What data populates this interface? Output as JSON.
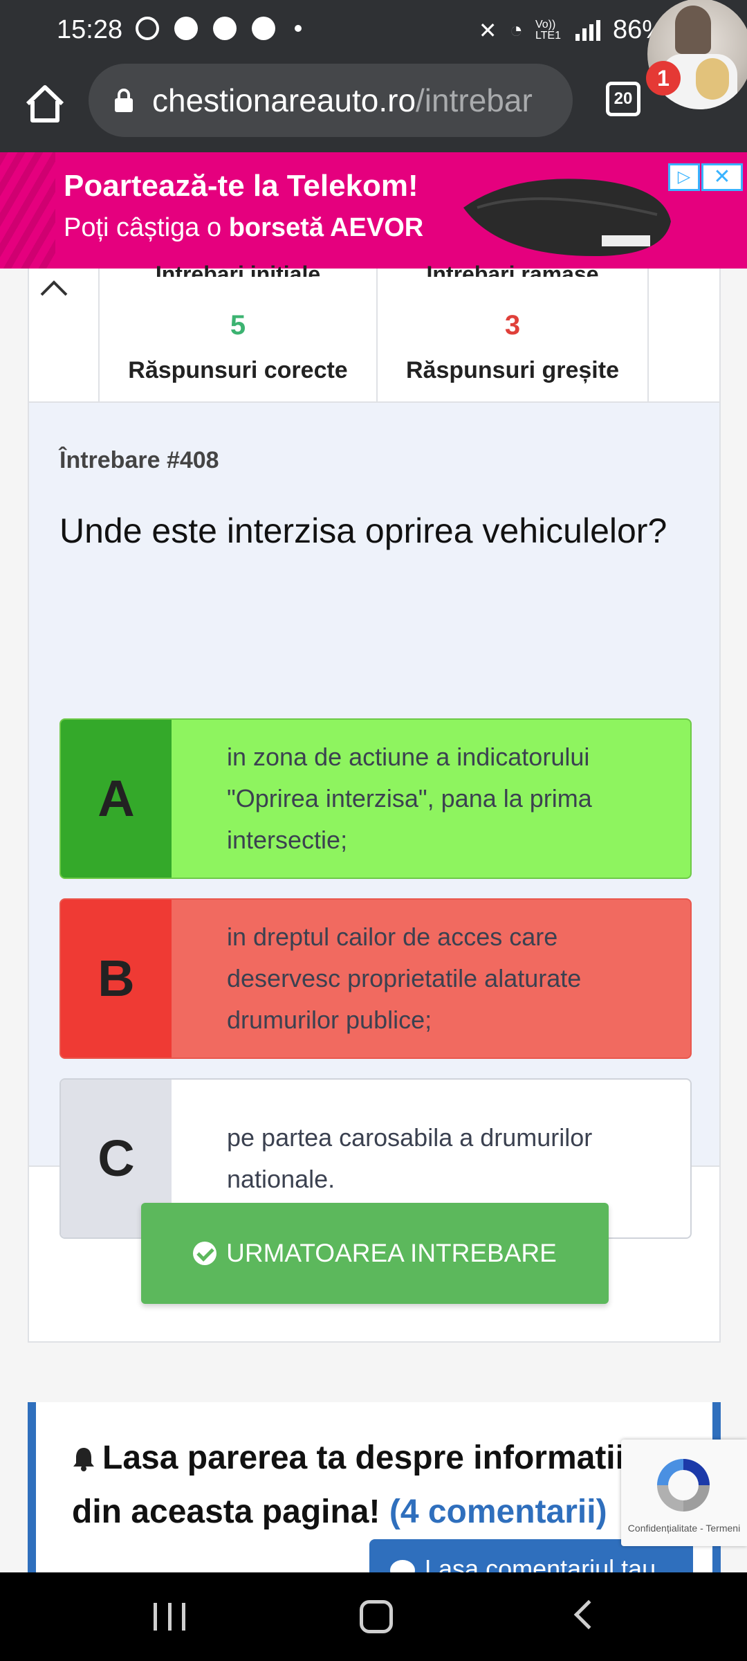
{
  "status_bar": {
    "time": "15:28",
    "battery": "86%",
    "network": "Vo)) LTE1"
  },
  "browser": {
    "url_host": "chestionareauto.ro",
    "url_path": "/intrebar",
    "tab_count": "20",
    "notification_count": "1"
  },
  "ad": {
    "title": "Poartează-te la Telekom!",
    "subtitle_plain": "Poți câștiga o ",
    "subtitle_bold": "borsetă AEVOR",
    "close_icon": "close-icon",
    "brand_color": "#e5007e"
  },
  "stats": {
    "clipped_left": "Intrebari initiale",
    "clipped_right": "Intrebari ramase",
    "correct_count": "5",
    "correct_label": "Răspunsuri corecte",
    "correct_color": "#3cb371",
    "wrong_count": "3",
    "wrong_label": "Răspunsuri greșite",
    "wrong_color": "#e0403a"
  },
  "question": {
    "number": "Întrebare #408",
    "text": "Unde este interzisa oprirea vehiculelor?",
    "answers": [
      {
        "letter": "A",
        "text": "in zona de actiune a indicatorului \"Oprirea interzisa\", pana la prima intersectie;",
        "state": "correct"
      },
      {
        "letter": "B",
        "text": "in dreptul cailor de acces care deservesc proprietatile alaturate drumurilor publice;",
        "state": "wrong"
      },
      {
        "letter": "C",
        "text": "pe partea carosabila a drumurilor nationale.",
        "state": "neutral"
      }
    ]
  },
  "next_button": {
    "label": "URMATOAREA INTREBARE",
    "color": "#5cb85c"
  },
  "comments": {
    "text": "Lasa parerea ta despre informatiile din aceasta pagina!",
    "link": "(4 comentarii)",
    "leave_button": "Lasa comentariul tau"
  },
  "recaptcha": {
    "text": "Confidențialitate - Termeni"
  }
}
